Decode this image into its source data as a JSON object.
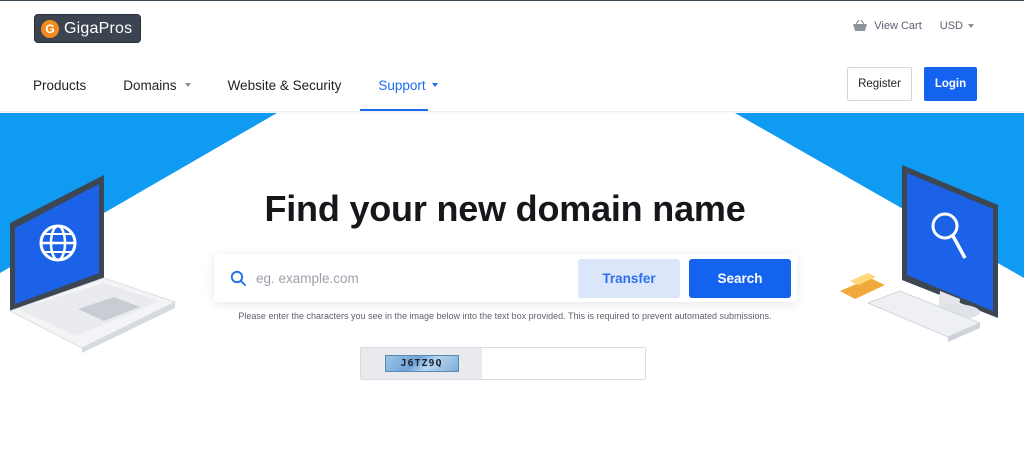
{
  "brand": {
    "name": "GigaPros",
    "logo_letter": "G"
  },
  "topbar": {
    "cart_label": "View Cart",
    "currency": "USD"
  },
  "nav": {
    "items": [
      {
        "label": "Products",
        "dropdown": false,
        "active": false
      },
      {
        "label": "Domains",
        "dropdown": true,
        "active": false
      },
      {
        "label": "Website & Security",
        "dropdown": false,
        "active": false
      },
      {
        "label": "Support",
        "dropdown": true,
        "active": true
      }
    ],
    "register_label": "Register",
    "login_label": "Login"
  },
  "hero": {
    "headline": "Find your new domain name",
    "search_placeholder": "eg. example.com",
    "transfer_label": "Transfer",
    "search_label": "Search",
    "captcha_note": "Please enter the characters you see in the image below into the text box provided. This is required to prevent automated submissions.",
    "captcha_code": "J6TZ9Q"
  },
  "colors": {
    "accent": "#1462f0",
    "hero_blue": "#0f9bf2",
    "logo_bg": "#3b4450",
    "logo_mark": "#f28c1e"
  },
  "icons": {
    "cart": "basket-icon",
    "search": "search-icon",
    "laptop_left": "laptop-globe-icon",
    "desktop_right": "desktop-magnifier-icon"
  }
}
